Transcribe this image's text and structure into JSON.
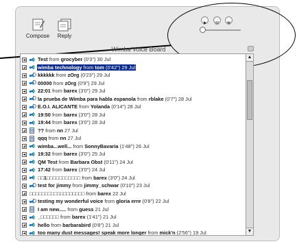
{
  "toolbar": {
    "compose_label": "Compose",
    "reply_label": "Reply"
  },
  "board": {
    "title": "Wimba Voice Board"
  },
  "messages": [
    {
      "subject": "Test",
      "from_word": "from",
      "author": "grocyber",
      "meta": "(0'3\") 30 Jul",
      "icon": "speaker",
      "selected": false
    },
    {
      "subject": "wimba technology",
      "from_word": "from",
      "author": "tom",
      "meta": "(0'42\") 29 Jul",
      "icon": "speaker",
      "selected": true
    },
    {
      "subject": "kkkkkk",
      "from_word": "from",
      "author": "zOrg",
      "meta": "(0'23\") 29 Jul",
      "icon": "both",
      "selected": false
    },
    {
      "subject": "00000",
      "from_word": "from",
      "author": "zOrg",
      "meta": "(0'9\") 29 Jul",
      "icon": "both",
      "selected": false
    },
    {
      "subject": "22:01",
      "from_word": "from",
      "author": "barex",
      "meta": "(3'0\") 29 Jul",
      "icon": "speaker",
      "selected": false
    },
    {
      "subject": "la prueba de Wimba para habla espanola",
      "from_word": "from",
      "author": "rblake",
      "meta": "(0'7\") 28 Jul",
      "icon": "both",
      "selected": false
    },
    {
      "subject": "E.O.I. ALICANTE",
      "from_word": "from",
      "author": "Yolanda",
      "meta": "(0'14\") 28 Jul",
      "icon": "both",
      "selected": false
    },
    {
      "subject": "19:50",
      "from_word": "from",
      "author": "barex",
      "meta": "(3'0\") 28 Jul",
      "icon": "speaker",
      "selected": false
    },
    {
      "subject": "19:44",
      "from_word": "from",
      "author": "barex",
      "meta": "(3'0\") 28 Jul",
      "icon": "speaker",
      "selected": false
    },
    {
      "subject": "??",
      "from_word": "from",
      "author": "nn",
      "meta": "27 Jul",
      "icon": "doc",
      "selected": false
    },
    {
      "subject": "qqq",
      "from_word": "from",
      "author": "nn",
      "meta": "27 Jul",
      "icon": "doc",
      "selected": false
    },
    {
      "subject": "wimba...well...",
      "from_word": "from",
      "author": "SonnyBavaria",
      "meta": "(1'48\") 26 Jul",
      "icon": "speaker",
      "selected": false
    },
    {
      "subject": "19:32",
      "from_word": "from",
      "author": "barex",
      "meta": "(3'0\") 25 Jul",
      "icon": "speaker",
      "selected": false
    },
    {
      "subject": "QM Test",
      "from_word": "from",
      "author": "Barbara Obst",
      "meta": "(0'11\") 24 Jul",
      "icon": "speaker",
      "selected": false
    },
    {
      "subject": "17:42",
      "from_word": "from",
      "author": "barex",
      "meta": "(3'0\") 24 Jul",
      "icon": "speaker",
      "selected": false
    },
    {
      "subject": "□□1□□□□□□□□□□□",
      "from_word": "from",
      "author": "barex",
      "meta": "(3'0\") 24 Jul",
      "icon": "speaker",
      "selected": false
    },
    {
      "subject": "test for jimmy",
      "from_word": "from",
      "author": "jimmy_schwar",
      "meta": "(0'10\") 23 Jul",
      "icon": "both",
      "selected": false
    },
    {
      "subject": "□□□□□□□□□□□□□□□□□□",
      "from_word": "from",
      "author": "barex",
      "meta": "22 Jul",
      "icon": "none",
      "selected": false
    },
    {
      "subject": "testing my wonderful voice",
      "from_word": "from",
      "author": "gloria erre",
      "meta": "(0'8\") 22 Jul",
      "icon": "both",
      "selected": false
    },
    {
      "subject": "I am new.....",
      "from_word": "from",
      "author": "guess",
      "meta": "21 Jul",
      "icon": "doc",
      "selected": false
    },
    {
      "subject": "_□□□□□□",
      "from_word": "from",
      "author": "barex",
      "meta": "(1'41\") 21 Jul",
      "icon": "speaker",
      "selected": false
    },
    {
      "subject": "hello",
      "from_word": "from",
      "author": "barbarabird",
      "meta": "(0'8\") 21 Jul",
      "icon": "speaker",
      "selected": false
    },
    {
      "subject": "too many dust messages! speak more longer",
      "from_word": "from",
      "author": "mick'n",
      "meta": "(2'56\") 19 Jul",
      "icon": "speaker",
      "selected": false
    }
  ],
  "colors": {
    "selection": "#0a2a8a",
    "accent": "#1a7ac9"
  }
}
